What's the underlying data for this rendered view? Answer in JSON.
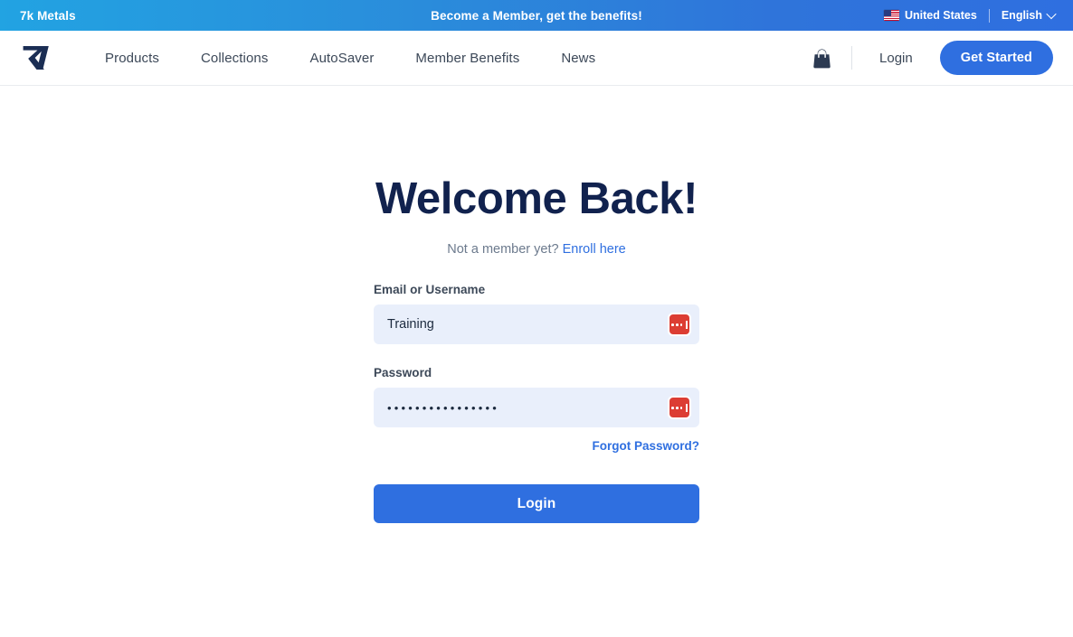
{
  "announcement": {
    "brand": "7k Metals",
    "message": "Become a Member, get the benefits!",
    "country": "United States",
    "country_flag_icon": "us-flag-icon",
    "language": "English",
    "chevron_icon": "chevron-down-icon",
    "gradient_start_color": "#22a3e2",
    "gradient_end_color": "#2f6fe0",
    "text_color": "#ffffff"
  },
  "nav": {
    "logo_icon": "7k-logo-icon",
    "links": [
      {
        "label": "Products"
      },
      {
        "label": "Collections"
      },
      {
        "label": "AutoSaver"
      },
      {
        "label": "Member Benefits"
      },
      {
        "label": "News"
      }
    ],
    "cart_icon": "shopping-bag-icon",
    "login_label": "Login",
    "get_started_label": "Get Started",
    "accent_color": "#2f6fe0",
    "link_color": "#3c4858"
  },
  "main": {
    "title": "Welcome Back!",
    "title_color": "#11224e",
    "enroll_prompt": "Not a member yet?",
    "enroll_link_label": "Enroll here",
    "form": {
      "username": {
        "label": "Email or Username",
        "value": "Training",
        "placeholder": "",
        "manager_icon": "password-manager-icon"
      },
      "password": {
        "label": "Password",
        "value": "••••••••••••••••",
        "placeholder": "",
        "manager_icon": "password-manager-icon"
      },
      "forgot_label": "Forgot Password?",
      "submit_label": "Login",
      "field_bg_color": "#e9effb",
      "submit_color": "#2f6fe0"
    }
  }
}
